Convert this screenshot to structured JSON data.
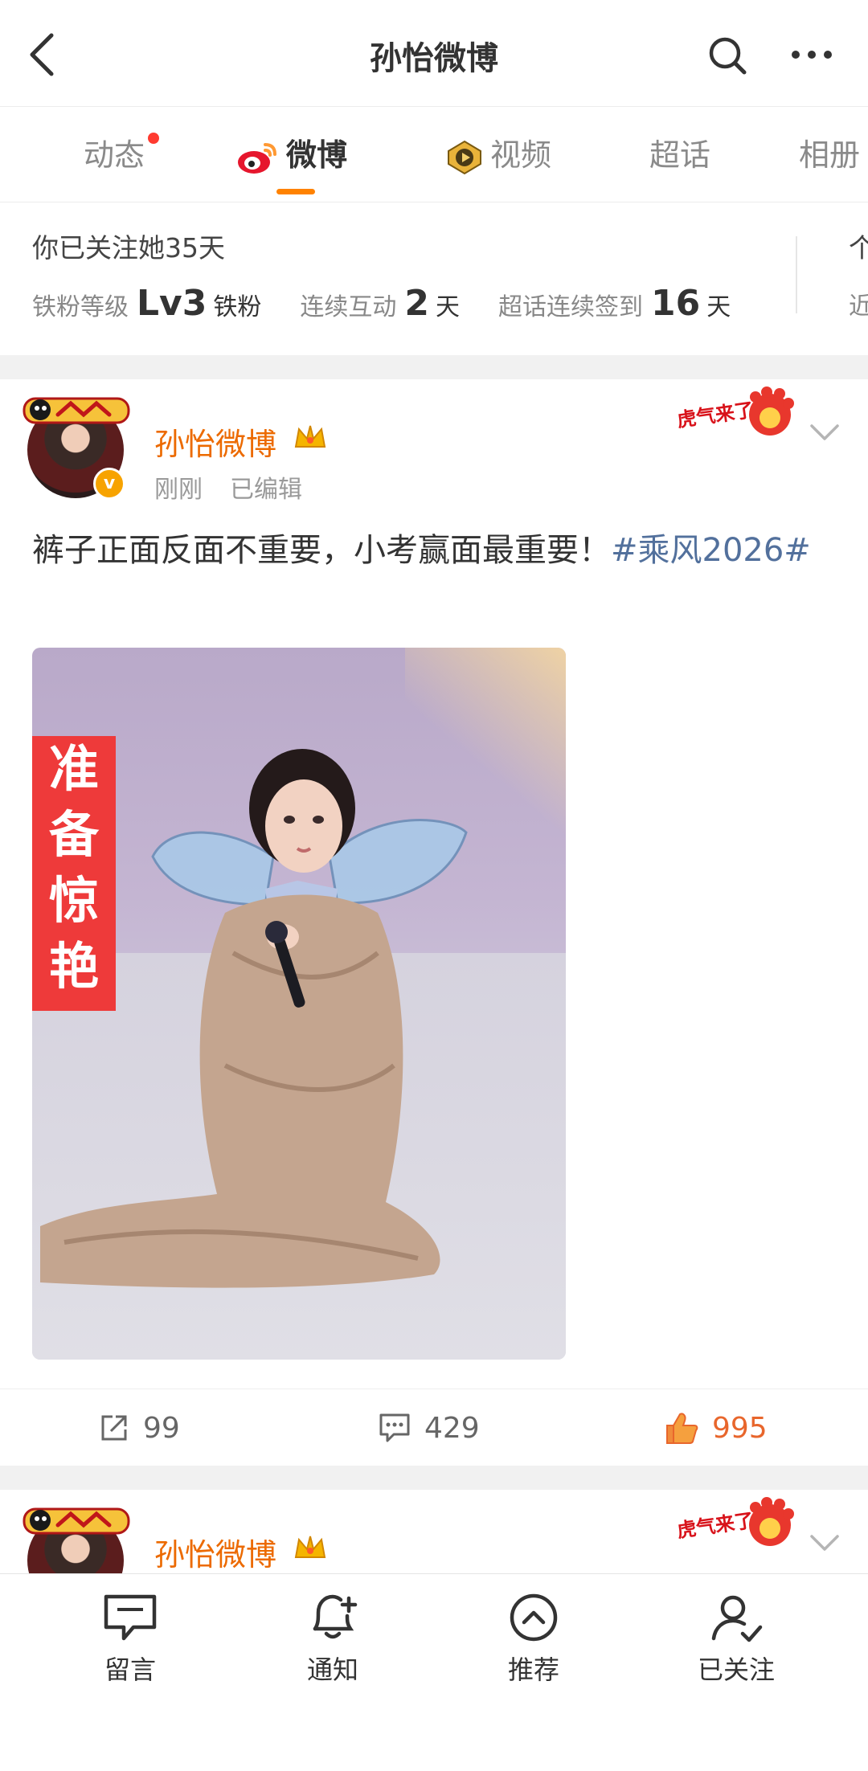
{
  "header": {
    "title": "孙怡微博",
    "back_icon": "chevron-left-icon",
    "search_icon": "search-icon",
    "more_icon": "more-dots-icon"
  },
  "tabs": [
    {
      "label": "动态",
      "has_red_dot": true
    },
    {
      "label": "微博",
      "active": true,
      "icon": "weibo-logo-icon"
    },
    {
      "label": "视频",
      "icon": "video-play-icon"
    },
    {
      "label": "超话"
    },
    {
      "label": "相册"
    }
  ],
  "fan_info": {
    "follow_days_text": "你已关注她35天",
    "level_label": "铁粉等级",
    "level_value": "Lv3",
    "level_unit": "铁粉",
    "interact_label": "连续互动",
    "interact_value": "2",
    "interact_unit": "天",
    "checkin_label": "超话连续签到",
    "checkin_value": "16",
    "checkin_unit": "天",
    "peek_top": "个",
    "peek_bottom": "近"
  },
  "posts": [
    {
      "author": "孙怡微博",
      "time": "刚刚",
      "edited": "已编辑",
      "badge_text": "虎气来了",
      "text": "裤子正面反面不重要，小考赢面最重要！",
      "hashtag": "#乘风2026#",
      "image_sign": [
        "准",
        "备",
        "惊",
        "艳"
      ],
      "reposts": "99",
      "comments": "429",
      "likes": "995"
    },
    {
      "author": "孙怡微博",
      "badge_text": "虎气来了"
    }
  ],
  "bottom_bar": [
    {
      "label": "留言",
      "icon": "comment-bubble-icon"
    },
    {
      "label": "通知",
      "icon": "bell-plus-icon"
    },
    {
      "label": "推荐",
      "icon": "chevron-up-circle-icon"
    },
    {
      "label": "已关注",
      "icon": "user-check-icon"
    }
  ],
  "colors": {
    "accent_orange": "#ff8200",
    "author_orange": "#ec6a00",
    "hashtag_blue": "#52709c",
    "like_orange": "#e8662c",
    "sign_red": "#ee3a3a"
  }
}
